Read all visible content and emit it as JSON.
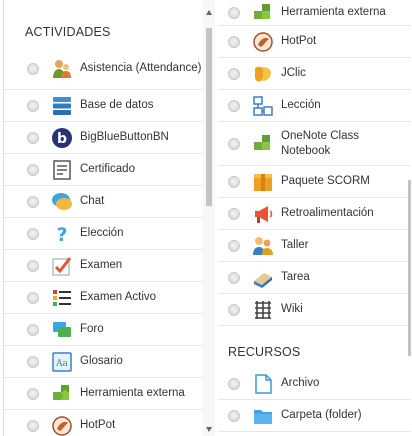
{
  "left": {
    "header": "ACTIVIDADES",
    "items": [
      {
        "label": "Asistencia (Attendance)",
        "icon": "attendance-icon"
      },
      {
        "label": "Base de datos",
        "icon": "database-icon"
      },
      {
        "label": "BigBlueButtonBN",
        "icon": "bigbluebutton-icon"
      },
      {
        "label": "Certificado",
        "icon": "certificate-icon"
      },
      {
        "label": "Chat",
        "icon": "chat-icon"
      },
      {
        "label": "Elección",
        "icon": "choice-icon"
      },
      {
        "label": "Examen",
        "icon": "quiz-icon"
      },
      {
        "label": "Examen Activo",
        "icon": "active-quiz-icon"
      },
      {
        "label": "Foro",
        "icon": "forum-icon"
      },
      {
        "label": "Glosario",
        "icon": "glossary-icon"
      },
      {
        "label": "Herramienta externa",
        "icon": "external-tool-icon"
      },
      {
        "label": "HotPot",
        "icon": "hotpot-icon"
      }
    ]
  },
  "right": {
    "items": [
      {
        "label": "Herramienta externa",
        "icon": "external-tool-icon"
      },
      {
        "label": "HotPot",
        "icon": "hotpot-icon"
      },
      {
        "label": "JClic",
        "icon": "jclic-icon"
      },
      {
        "label": "Lección",
        "icon": "lesson-icon"
      },
      {
        "label": "OneNote Class Notebook",
        "icon": "onenote-puzzle-icon"
      },
      {
        "label": "Paquete SCORM",
        "icon": "scorm-package-icon"
      },
      {
        "label": "Retroalimentación",
        "icon": "feedback-megaphone-icon"
      },
      {
        "label": "Taller",
        "icon": "workshop-icon"
      },
      {
        "label": "Tarea",
        "icon": "assignment-icon"
      },
      {
        "label": "Wiki",
        "icon": "wiki-icon"
      }
    ],
    "resources_header": "RECURSOS",
    "resources": [
      {
        "label": "Archivo",
        "icon": "file-icon"
      },
      {
        "label": "Carpeta (folder)",
        "icon": "folder-icon"
      }
    ]
  }
}
